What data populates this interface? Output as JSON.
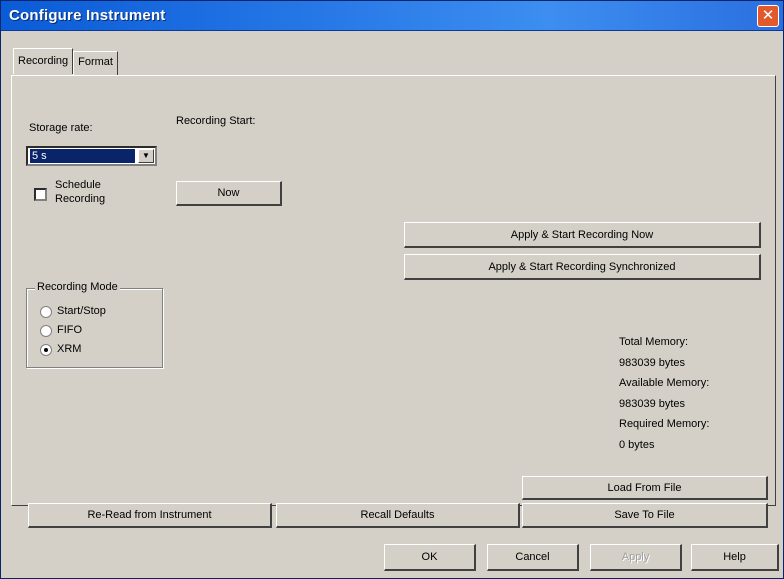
{
  "window": {
    "title": "Configure Instrument",
    "close_glyph": "✕"
  },
  "tabs": [
    {
      "label": "Recording",
      "active": true
    },
    {
      "label": "Format",
      "active": false
    }
  ],
  "recording": {
    "storage_rate_label": "Storage rate:",
    "storage_rate_value": "5 s",
    "schedule_label_line1": "Schedule",
    "schedule_label_line2": "Recording",
    "schedule_checked": false,
    "recording_start_label": "Recording Start:",
    "now_button": "Now",
    "apply_start_now": "Apply & Start Recording Now",
    "apply_start_sync": "Apply & Start Recording Synchronized",
    "mode_group_title": "Recording Mode",
    "modes": [
      {
        "label": "Start/Stop",
        "checked": false
      },
      {
        "label": "FIFO",
        "checked": false
      },
      {
        "label": "XRM",
        "checked": true
      }
    ]
  },
  "memory": {
    "total_label": "Total Memory:",
    "total_value": "983039 bytes",
    "available_label": "Available Memory:",
    "available_value": "983039 bytes",
    "required_label": "Required Memory:",
    "required_value": "0 bytes"
  },
  "actions": {
    "reread": "Re-Read from Instrument",
    "recall_defaults": "Recall Defaults",
    "load_from_file": "Load From File",
    "save_to_file": "Save To File"
  },
  "dialog_buttons": {
    "ok": "OK",
    "cancel": "Cancel",
    "apply": "Apply",
    "help": "Help"
  },
  "icons": {
    "dropdown": "chevron-down-icon",
    "close": "close-icon"
  }
}
